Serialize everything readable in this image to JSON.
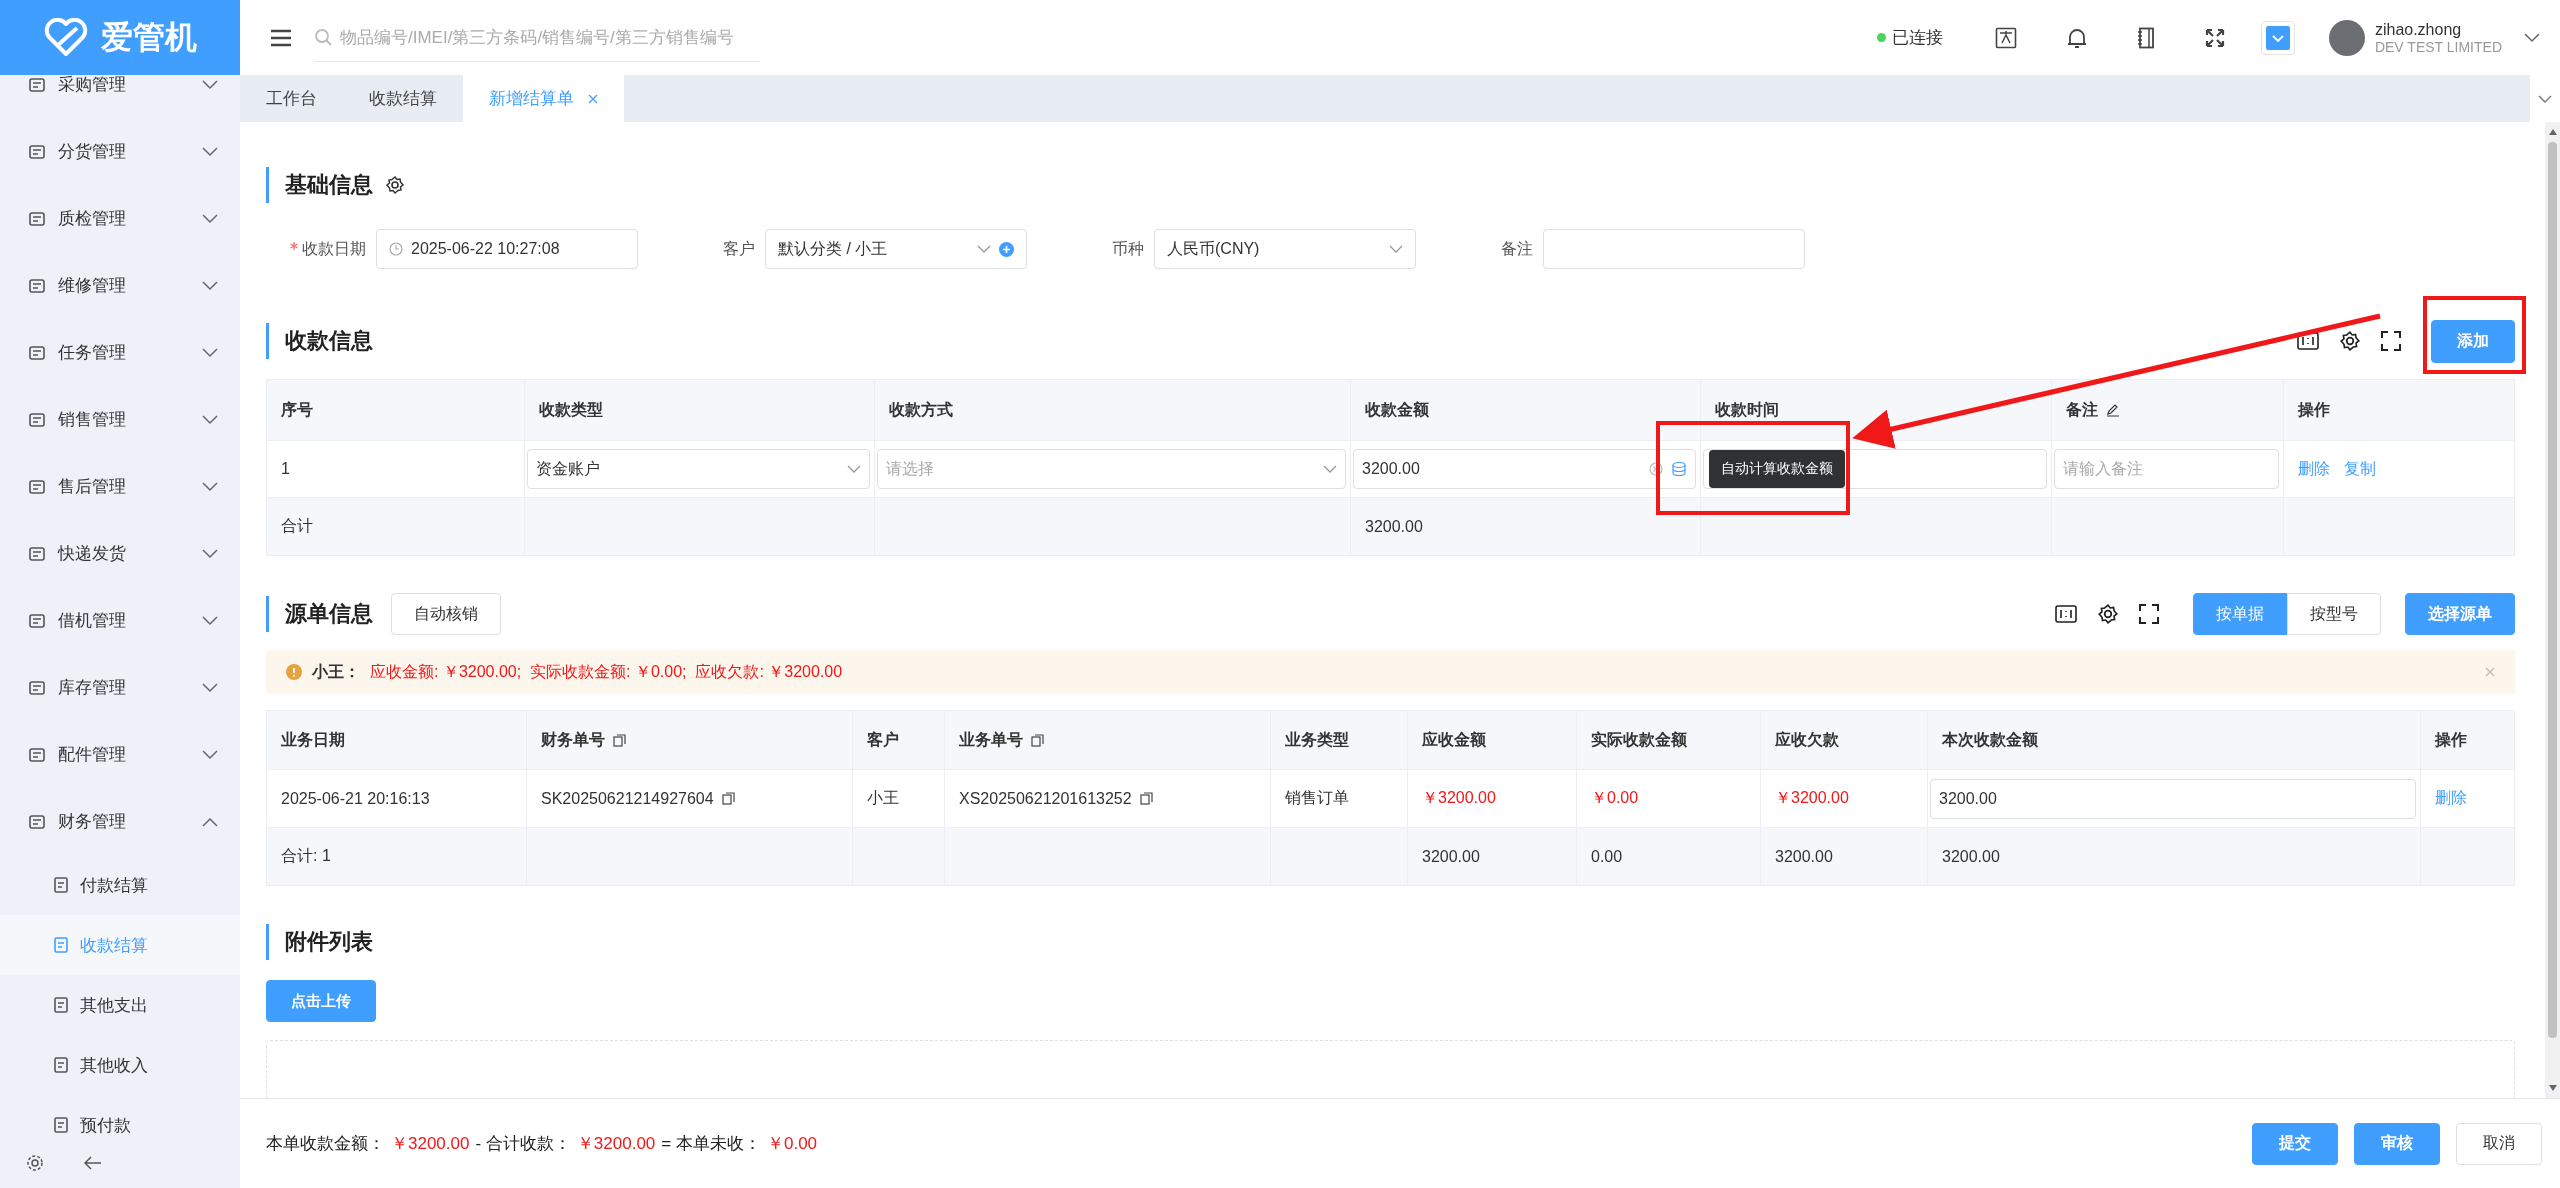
{
  "app": {
    "logo_text": "爱管机"
  },
  "sidebar": {
    "items": [
      {
        "label": "采购管理",
        "expanded": false
      },
      {
        "label": "分货管理",
        "expanded": false
      },
      {
        "label": "质检管理",
        "expanded": false
      },
      {
        "label": "维修管理",
        "expanded": false
      },
      {
        "label": "任务管理",
        "expanded": false
      },
      {
        "label": "销售管理",
        "expanded": false
      },
      {
        "label": "售后管理",
        "expanded": false
      },
      {
        "label": "快递发货",
        "expanded": false
      },
      {
        "label": "借机管理",
        "expanded": false
      },
      {
        "label": "库存管理",
        "expanded": false
      },
      {
        "label": "配件管理",
        "expanded": false
      },
      {
        "label": "财务管理",
        "expanded": true,
        "children": [
          {
            "label": "付款结算",
            "selected": false
          },
          {
            "label": "收款结算",
            "selected": true
          },
          {
            "label": "其他支出",
            "selected": false
          },
          {
            "label": "其他收入",
            "selected": false
          },
          {
            "label": "预付款",
            "selected": false
          }
        ]
      }
    ]
  },
  "header": {
    "search": {
      "placeholder": "物品编号/IMEI/第三方条码/销售编号/第三方销售编号"
    },
    "status": {
      "label": "已连接",
      "connected": true
    },
    "user": {
      "name": "zihao.zhong",
      "company": "DEV TEST LIMITED"
    }
  },
  "tabs": [
    {
      "label": "工作台",
      "selected": false
    },
    {
      "label": "收款结算",
      "selected": false
    },
    {
      "label": "新增结算单",
      "selected": true
    }
  ],
  "basic_info": {
    "title": "基础信息",
    "fields": [
      {
        "kind": "date",
        "label": "收款日期",
        "required": true,
        "value": "2025-06-22 10:27:08"
      },
      {
        "kind": "select",
        "label": "客户",
        "required": false,
        "value": "默认分类 / 小王",
        "addable": true
      },
      {
        "kind": "select",
        "label": "币种",
        "required": false,
        "value": "人民币(CNY)",
        "addable": false
      },
      {
        "kind": "input",
        "label": "备注",
        "required": false
      }
    ]
  },
  "payment_info": {
    "title": "收款信息",
    "add_button": "添加",
    "tooltip": "自动计算收款金额",
    "columns": [
      {
        "label": "序号",
        "editable": false
      },
      {
        "label": "收款类型",
        "editable": false
      },
      {
        "label": "收款方式",
        "editable": false
      },
      {
        "label": "收款金额",
        "editable": false
      },
      {
        "label": "收款时间",
        "editable": false
      },
      {
        "label": "备注",
        "editable": true
      },
      {
        "label": "操作",
        "editable": false
      }
    ],
    "rows": [
      [
        {
          "kind": "text",
          "text": "1"
        },
        {
          "kind": "select",
          "value": "资金账户"
        },
        {
          "kind": "select",
          "placeholder": "请选择"
        },
        {
          "kind": "amount",
          "value": "3200.00"
        },
        {
          "kind": "input"
        },
        {
          "kind": "input",
          "placeholder": "请输入备注"
        },
        {
          "kind": "links",
          "links": [
            "删除",
            "复制"
          ]
        }
      ],
      [
        {
          "kind": "text",
          "text": "合计"
        },
        {
          "kind": "empty"
        },
        {
          "kind": "empty"
        },
        {
          "kind": "text",
          "text": "3200.00"
        },
        {
          "kind": "empty"
        },
        {
          "kind": "empty"
        },
        {
          "kind": "empty"
        }
      ]
    ]
  },
  "source_info": {
    "title": "源单信息",
    "auto_button": "自动核销",
    "view_toggle": [
      {
        "label": "按单据",
        "selected": true
      },
      {
        "label": "按型号",
        "selected": false
      }
    ],
    "select_button": "选择源单",
    "alert": {
      "name": "小王：",
      "text": "应收金额: ￥3200.00;  实际收款金额: ￥0.00;  应收欠款: ￥3200.00"
    },
    "columns": [
      {
        "label": "业务日期",
        "copyable": false
      },
      {
        "label": "财务单号",
        "copyable": true
      },
      {
        "label": "客户",
        "copyable": false
      },
      {
        "label": "业务单号",
        "copyable": true
      },
      {
        "label": "业务类型",
        "copyable": false
      },
      {
        "label": "应收金额",
        "copyable": false
      },
      {
        "label": "实际收款金额",
        "copyable": false
      },
      {
        "label": "应收欠款",
        "copyable": false
      },
      {
        "label": "本次收款金额",
        "copyable": false
      },
      {
        "label": "操作",
        "copyable": false
      }
    ],
    "rows": [
      [
        {
          "kind": "text",
          "text": "2025-06-21 20:16:13"
        },
        {
          "kind": "copy",
          "text": "SK20250621214927604"
        },
        {
          "kind": "text",
          "text": "小王"
        },
        {
          "kind": "copy",
          "text": "XS20250621201613252"
        },
        {
          "kind": "text",
          "text": "销售订单"
        },
        {
          "kind": "money",
          "text": "￥3200.00"
        },
        {
          "kind": "money",
          "text": "￥0.00"
        },
        {
          "kind": "money",
          "text": "￥3200.00"
        },
        {
          "kind": "input",
          "value": "3200.00"
        },
        {
          "kind": "links",
          "links": [
            "删除"
          ]
        }
      ],
      [
        {
          "kind": "text",
          "text": "合计: 1"
        },
        {
          "kind": "empty"
        },
        {
          "kind": "empty"
        },
        {
          "kind": "empty"
        },
        {
          "kind": "empty"
        },
        {
          "kind": "text",
          "text": "3200.00"
        },
        {
          "kind": "text",
          "text": "0.00"
        },
        {
          "kind": "text",
          "text": "3200.00"
        },
        {
          "kind": "text",
          "text": "3200.00"
        },
        {
          "kind": "empty"
        }
      ]
    ]
  },
  "attachments": {
    "title": "附件列表",
    "upload_button": "点击上传"
  },
  "footer": {
    "summary": [
      {
        "kind": "label",
        "text": "本单收款金额："
      },
      {
        "kind": "amount",
        "text": "￥3200.00"
      },
      {
        "kind": "label",
        "text": "- 合计收款："
      },
      {
        "kind": "amount",
        "text": "￥3200.00"
      },
      {
        "kind": "label",
        "text": "= 本单未收："
      },
      {
        "kind": "amount",
        "text": "￥0.00"
      }
    ],
    "buttons": [
      {
        "label": "提交",
        "primary": true
      },
      {
        "label": "审核",
        "primary": true
      },
      {
        "label": "取消",
        "primary": false
      }
    ]
  }
}
